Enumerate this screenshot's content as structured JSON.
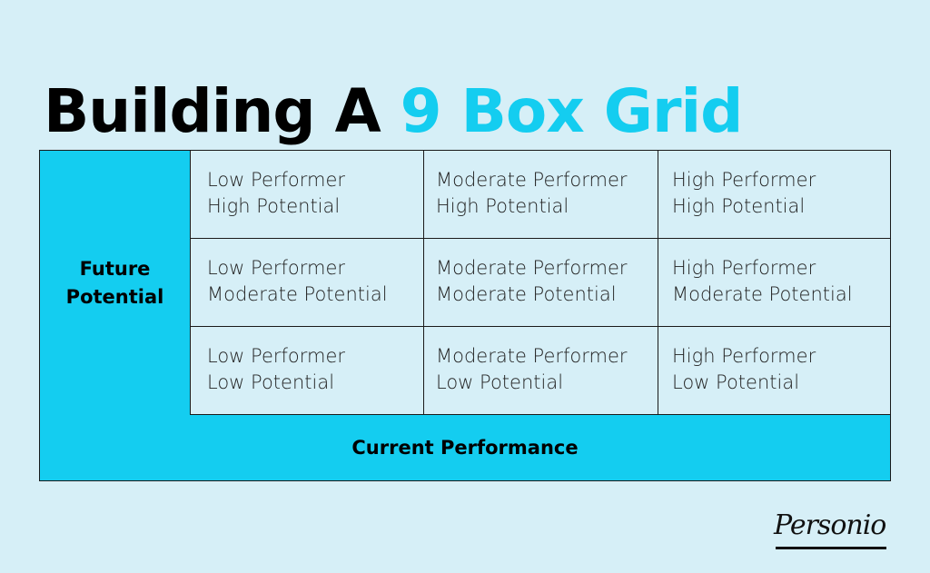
{
  "title": {
    "prefix": "Building A ",
    "accent": "9 Box Grid"
  },
  "colors": {
    "background": "#d6eff7",
    "accent": "#14cdf0",
    "text": "#000000"
  },
  "grid": {
    "y_axis_label": "Future Potential",
    "x_axis_label": "Current Performance",
    "rows": [
      {
        "potential": "High",
        "cells": [
          {
            "line1": "Low Performer",
            "line2": "High Potential"
          },
          {
            "line1": "Moderate Performer",
            "line2": "High Potential"
          },
          {
            "line1": "High Performer",
            "line2": "High Potential"
          }
        ]
      },
      {
        "potential": "Moderate",
        "cells": [
          {
            "line1": "Low Performer",
            "line2": "Moderate Potential"
          },
          {
            "line1": "Moderate Performer",
            "line2": "Moderate Potential"
          },
          {
            "line1": "High Performer",
            "line2": "Moderate Potential"
          }
        ]
      },
      {
        "potential": "Low",
        "cells": [
          {
            "line1": "Low Performer",
            "line2": "Low Potential"
          },
          {
            "line1": "Moderate Performer",
            "line2": "Low Potential"
          },
          {
            "line1": "High Performer",
            "line2": "Low Potential"
          }
        ]
      }
    ]
  },
  "logo": {
    "text": "Personio",
    "icon": "personio-logo"
  }
}
